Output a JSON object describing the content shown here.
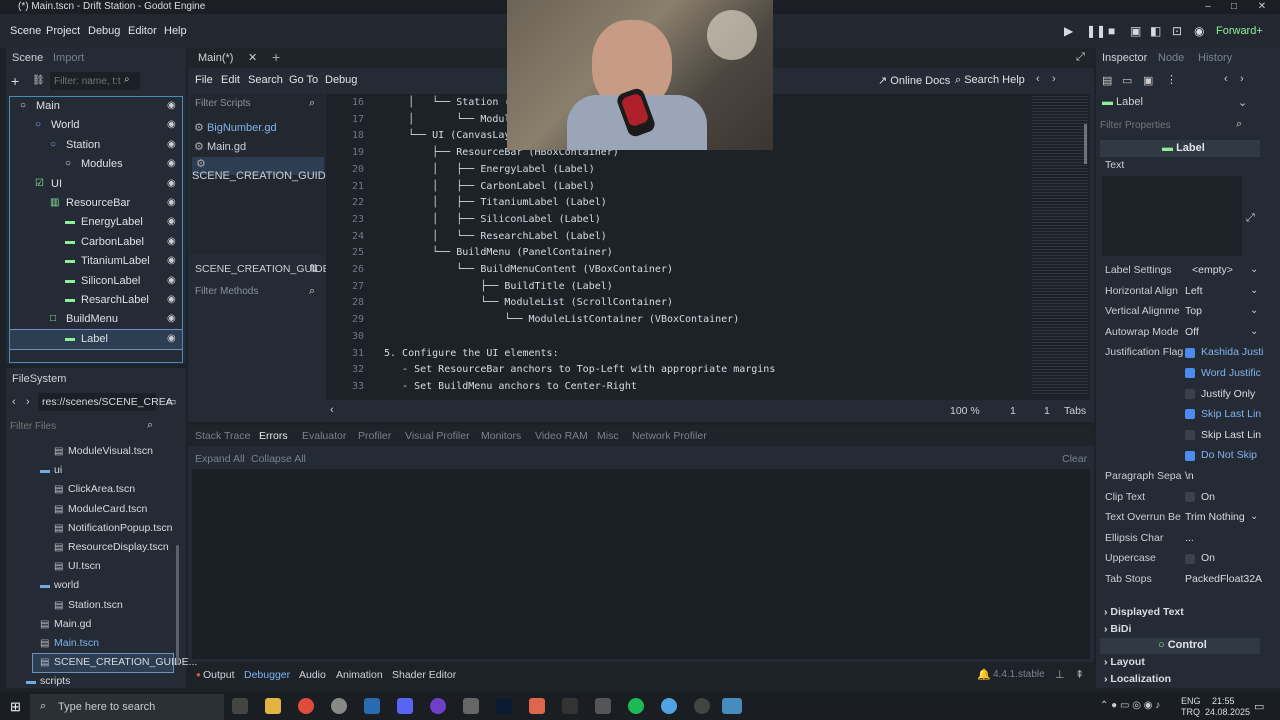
{
  "window": {
    "title": "(*) Main.tscn - Drift Station - Godot Engine"
  },
  "menubar": {
    "items": [
      "Scene",
      "Project",
      "Debug",
      "Editor",
      "Help"
    ],
    "renderer": "Forward+"
  },
  "scene_dock": {
    "tabs": [
      "Scene",
      "Import"
    ],
    "filter_placeholder": "Filter: name, t:t",
    "nodes": [
      {
        "label": "Main",
        "depth": 0
      },
      {
        "label": "World",
        "depth": 1
      },
      {
        "label": "Station",
        "depth": 2
      },
      {
        "label": "Modules",
        "depth": 3
      },
      {
        "label": "UI",
        "depth": 1
      },
      {
        "label": "ResourceBar",
        "depth": 2
      },
      {
        "label": "EnergyLabel",
        "depth": 3
      },
      {
        "label": "CarbonLabel",
        "depth": 3
      },
      {
        "label": "TitaniumLabel",
        "depth": 3
      },
      {
        "label": "SiliconLabel",
        "depth": 3
      },
      {
        "label": "ResarchLabel",
        "depth": 3
      },
      {
        "label": "BuildMenu",
        "depth": 2
      },
      {
        "label": "Label",
        "depth": 3
      }
    ]
  },
  "filesystem": {
    "title": "FileSystem",
    "path": "res://scenes/SCENE_CREA",
    "filter_placeholder": "Filter Files",
    "items": [
      {
        "label": "ModuleVisual.tscn",
        "depth": 2
      },
      {
        "label": "ui",
        "depth": 1
      },
      {
        "label": "ClickArea.tscn",
        "depth": 2
      },
      {
        "label": "ModuleCard.tscn",
        "depth": 2
      },
      {
        "label": "NotificationPopup.tscn",
        "depth": 2
      },
      {
        "label": "ResourceDisplay.tscn",
        "depth": 2
      },
      {
        "label": "UI.tscn",
        "depth": 2
      },
      {
        "label": "world",
        "depth": 1
      },
      {
        "label": "Station.tscn",
        "depth": 2
      },
      {
        "label": "Main.gd",
        "depth": 1
      },
      {
        "label": "Main.tscn",
        "depth": 1
      },
      {
        "label": "SCENE_CREATION_GUIDE...",
        "depth": 1
      },
      {
        "label": "scripts",
        "depth": 0
      }
    ]
  },
  "editor": {
    "tab": "Main(*)",
    "menus": [
      "File",
      "Edit",
      "Search",
      "Go To",
      "Debug"
    ],
    "online_docs": "Online Docs",
    "search_help": "Search Help",
    "filter_scripts": "Filter Scripts",
    "scripts": [
      "BigNumber.gd",
      "Main.gd",
      "SCENE_CREATION_GUID..."
    ],
    "current_doc": "SCENE_CREATION_GUIDE",
    "filter_methods": "Filter Methods",
    "lines": [
      {
        "n": "16",
        "t": "    │   └── Station (Node2D)"
      },
      {
        "n": "17",
        "t": "    │       └── Modules (N"
      },
      {
        "n": "18",
        "t": "    └── UI (CanvasLayer)"
      },
      {
        "n": "19",
        "t": "        ├── ResourceBar (HBoxContainer)"
      },
      {
        "n": "20",
        "t": "        │   ├── EnergyLabel (Label)"
      },
      {
        "n": "21",
        "t": "        │   ├── CarbonLabel (Label)"
      },
      {
        "n": "22",
        "t": "        │   ├── TitaniumLabel (Label)"
      },
      {
        "n": "23",
        "t": "        │   ├── SiliconLabel (Label)"
      },
      {
        "n": "24",
        "t": "        │   └── ResearchLabel (Label)"
      },
      {
        "n": "25",
        "t": "        └── BuildMenu (PanelContainer)"
      },
      {
        "n": "26",
        "t": "            └── BuildMenuContent (VBoxContainer)"
      },
      {
        "n": "27",
        "t": "                ├── BuildTitle (Label)"
      },
      {
        "n": "28",
        "t": "                └── ModuleList (ScrollContainer)"
      },
      {
        "n": "29",
        "t": "                    └── ModuleListContainer (VBoxContainer)"
      },
      {
        "n": "30",
        "t": ""
      },
      {
        "n": "31",
        "t": "5. Configure the UI elements:"
      },
      {
        "n": "32",
        "t": "   - Set ResourceBar anchors to Top-Left with appropriate margins"
      },
      {
        "n": "33",
        "t": "   - Set BuildMenu anchors to Center-Right"
      }
    ],
    "zoom": "100 %",
    "line": "1",
    "col": "1",
    "indent": "Tabs"
  },
  "debugger": {
    "tabs": [
      "Stack Trace",
      "Errors",
      "Evaluator",
      "Profiler",
      "Visual Profiler",
      "Monitors",
      "Video RAM",
      "Misc",
      "Network Profiler"
    ],
    "expand_all": "Expand All",
    "collapse_all": "Collapse All",
    "clear": "Clear"
  },
  "bottom_bar": {
    "tabs": [
      "Output",
      "Debugger",
      "Audio",
      "Animation",
      "Shader Editor"
    ],
    "version": "4.4.1.stable"
  },
  "inspector": {
    "tabs": [
      "Inspector",
      "Node",
      "History"
    ],
    "node": "Label",
    "filter_placeholder": "Filter Properties",
    "section": "Label",
    "text_label": "Text",
    "rows": [
      {
        "k": "Label Settings",
        "v": "<empty>"
      },
      {
        "k": "Horizontal Align",
        "v": "Left"
      },
      {
        "k": "Vertical Alignme",
        "v": "Top"
      },
      {
        "k": "Autowrap Mode",
        "v": "Off"
      },
      {
        "k": "Justification Flag",
        "v": "Kashida Justi"
      },
      {
        "k": "",
        "v": "Word Justific"
      },
      {
        "k": "",
        "v": "Justify Only"
      },
      {
        "k": "",
        "v": "Skip Last Lin"
      },
      {
        "k": "",
        "v": "Skip Last Lin"
      },
      {
        "k": "",
        "v": "Do Not Skip"
      },
      {
        "k": "Paragraph Sepa",
        "v": "\\n"
      },
      {
        "k": "Clip Text",
        "v": "On"
      },
      {
        "k": "Text Overrun Be",
        "v": "Trim Nothing"
      },
      {
        "k": "Ellipsis Char",
        "v": "..."
      },
      {
        "k": "Uppercase",
        "v": "On"
      },
      {
        "k": "Tab Stops",
        "v": "PackedFloat32A"
      }
    ],
    "groups": [
      "Displayed Text",
      "BiDi"
    ],
    "control": "Control",
    "control_groups": [
      "Layout",
      "Localization"
    ]
  },
  "taskbar": {
    "search": "Type here to search",
    "lang": "ENG",
    "lang2": "TRQ",
    "time": "21:55",
    "date": "24.08.2025"
  },
  "colors": {
    "accent": "#478cbf",
    "selected": "#2d3d52",
    "label_green": "#8eef97"
  }
}
